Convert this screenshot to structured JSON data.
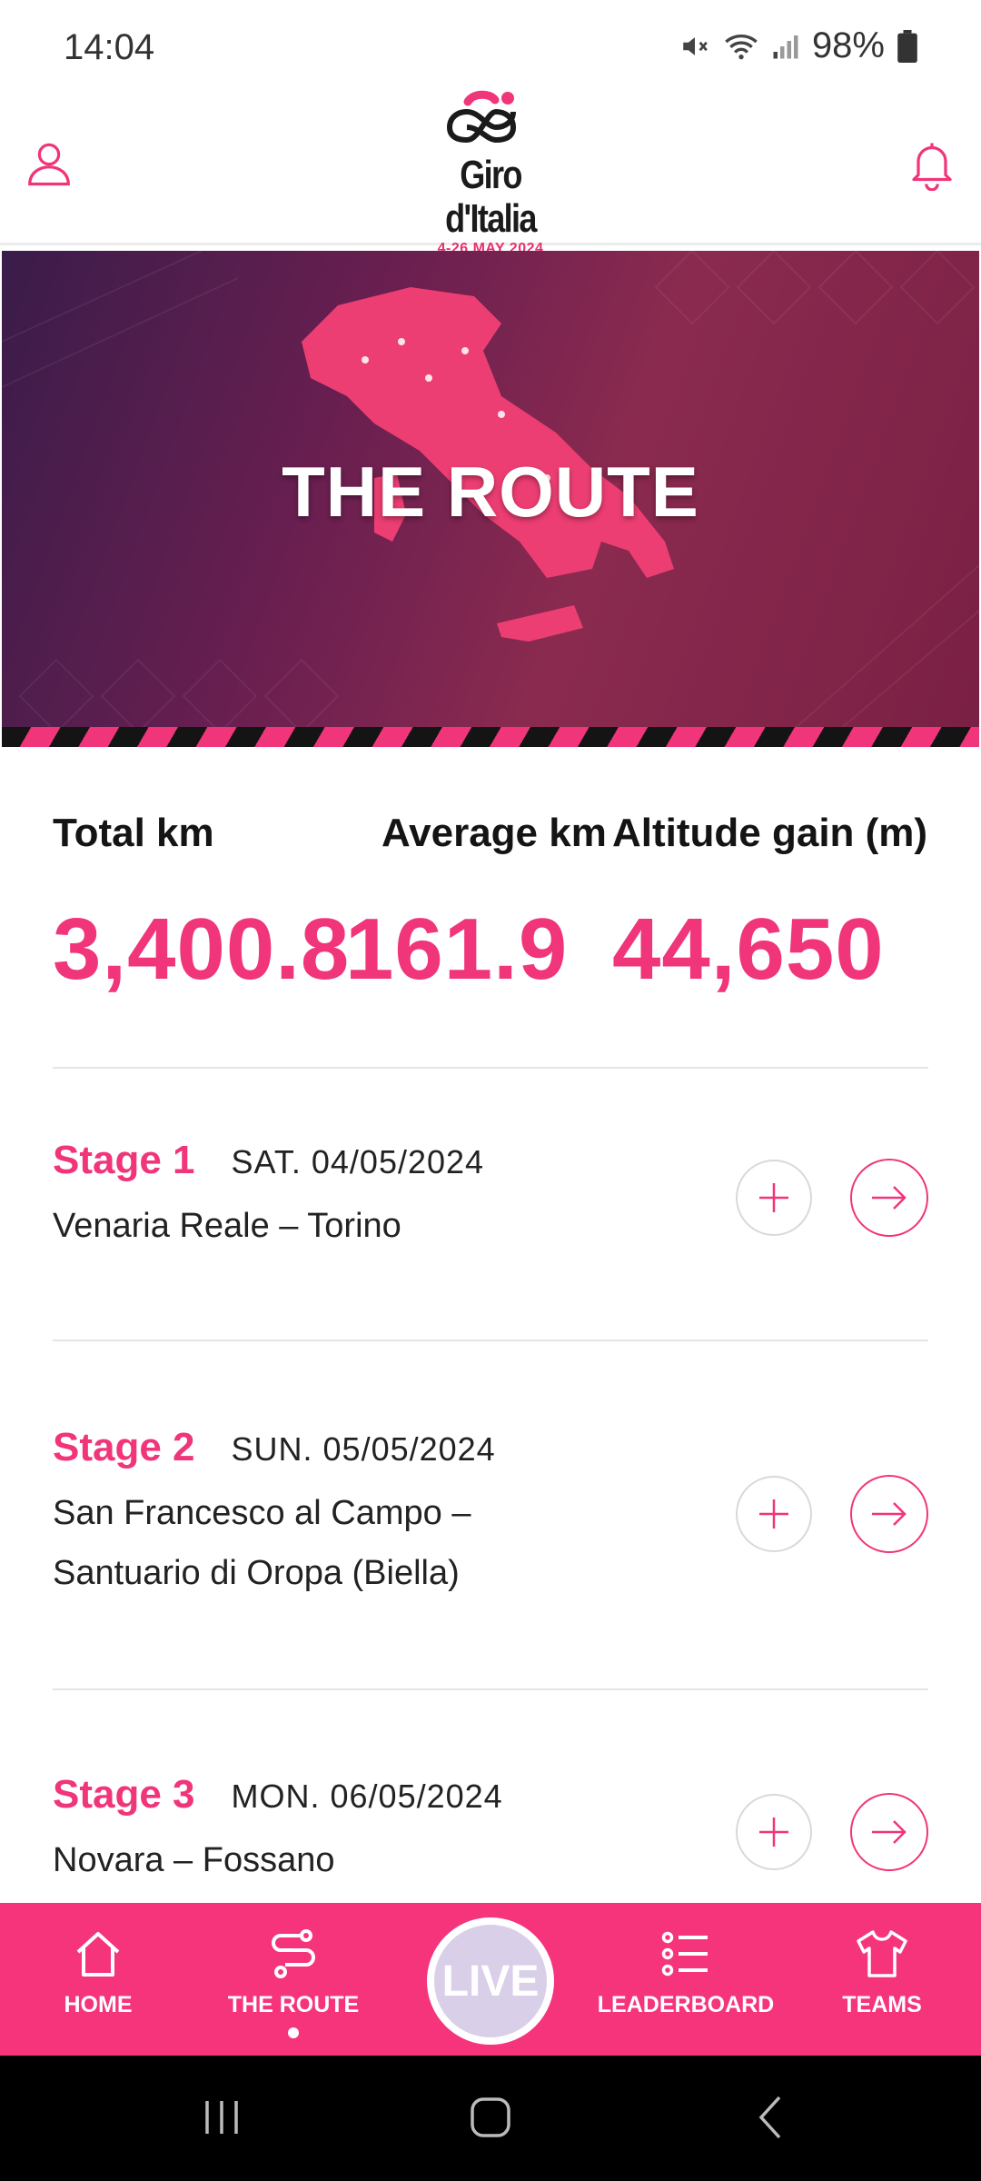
{
  "status_bar": {
    "time": "14:04",
    "battery": "98%"
  },
  "header": {
    "logo_name": "Giro d'Italia",
    "logo_dates": "4-26 MAY 2024"
  },
  "hero": {
    "title": "THE ROUTE"
  },
  "stats": [
    {
      "label": "Total km",
      "value": "3,400.8"
    },
    {
      "label": "Average km",
      "value": "161.9"
    },
    {
      "label": "Altitude gain (m)",
      "value": "44,650"
    }
  ],
  "stages": [
    {
      "number": "Stage 1",
      "date": "SAT. 04/05/2024",
      "route": "Venaria Reale – Torino"
    },
    {
      "number": "Stage 2",
      "date": "SUN. 05/05/2024",
      "route": "San Francesco al Campo – Santuario di Oropa (Biella)"
    },
    {
      "number": "Stage 3",
      "date": "MON. 06/05/2024",
      "route": "Novara – Fossano"
    }
  ],
  "bottom_nav": {
    "items": [
      {
        "label": "HOME",
        "icon": "home-icon"
      },
      {
        "label": "THE ROUTE",
        "icon": "route-icon",
        "active": true
      },
      {
        "label": "LIVE",
        "icon": "live"
      },
      {
        "label": "LEADERBOARD",
        "icon": "leaderboard-icon"
      },
      {
        "label": "TEAMS",
        "icon": "jersey-icon"
      }
    ]
  },
  "colors": {
    "accent": "#f0357a",
    "nav_bg": "#f5347c",
    "live_bg": "#d9cfe8"
  }
}
